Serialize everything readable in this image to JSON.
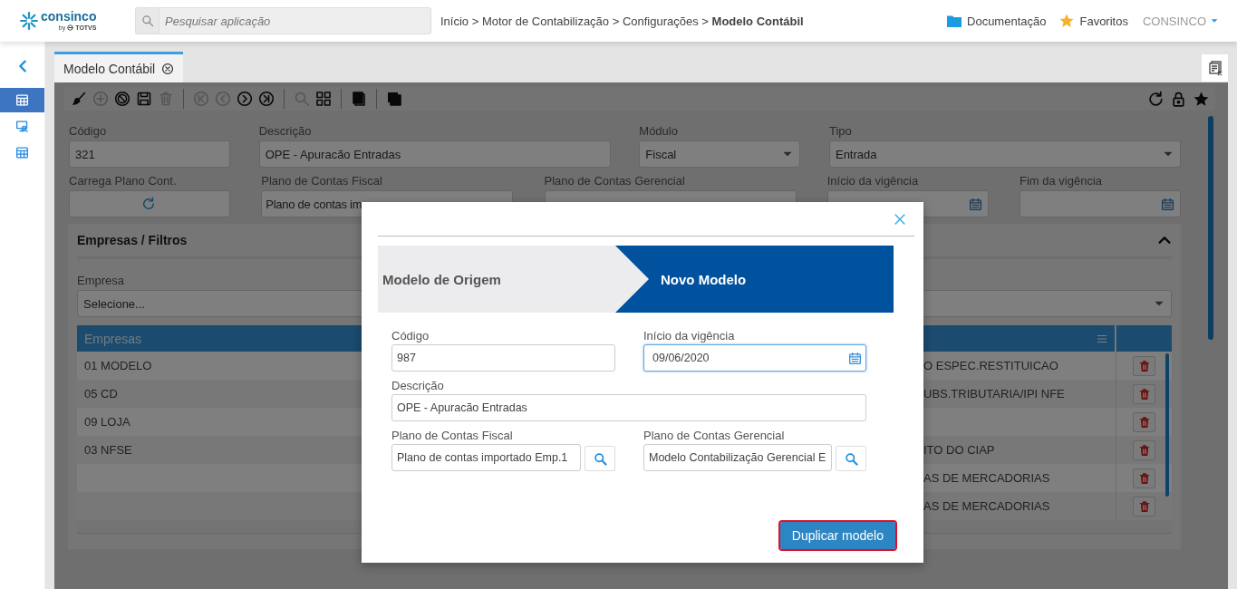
{
  "header": {
    "logo": {
      "name": "consinco",
      "byline": "by",
      "brand": "TOTVS"
    },
    "search": {
      "placeholder": "Pesquisar aplicação"
    },
    "breadcrumb": "Início > Motor de Contabilização > Configurações > **Modelo Contábil**",
    "links": [
      {
        "kind": "folder",
        "label": "Documentação"
      },
      {
        "kind": "star",
        "label": "Favoritos"
      }
    ],
    "user_menu": {
      "label": "CONSINCO"
    }
  },
  "sidebar": {
    "items": [
      {
        "kind": "grid",
        "selected": true
      },
      {
        "kind": "monitor",
        "selected": false
      },
      {
        "kind": "table",
        "selected": false
      }
    ]
  },
  "tabs": [
    {
      "label": "Modelo Contábil",
      "selected": true
    }
  ],
  "toolbar": {
    "groups": [
      {
        "items": [
          {
            "kind": "brush",
            "disabled": false
          },
          {
            "kind": "plus",
            "disabled": true
          },
          {
            "kind": "ban",
            "disabled": false
          },
          {
            "kind": "save",
            "disabled": false
          },
          {
            "kind": "trash",
            "disabled": true
          }
        ]
      },
      {
        "items": [
          {
            "kind": "first",
            "disabled": true
          },
          {
            "kind": "prev",
            "disabled": true
          },
          {
            "kind": "next",
            "disabled": false
          },
          {
            "kind": "last",
            "disabled": false
          }
        ]
      },
      {
        "items": [
          {
            "kind": "search",
            "disabled": true
          },
          {
            "kind": "grid",
            "disabled": false
          }
        ]
      },
      {
        "items": [
          {
            "kind": "copy",
            "disabled": false
          }
        ]
      },
      {
        "items": [
          {
            "kind": "layers",
            "disabled": false
          }
        ]
      }
    ],
    "right": [
      {
        "kind": "refresh",
        "disabled": false
      },
      {
        "kind": "lock",
        "disabled": false
      },
      {
        "kind": "star",
        "disabled": false
      }
    ]
  },
  "form": {
    "rows": [
      [
        {
          "kind": "text",
          "label": "Código",
          "value": "321"
        },
        {
          "kind": "text",
          "label": "Descrição",
          "value": "OPE - Apuracão Entradas"
        },
        {
          "kind": "select",
          "label": "Módulo",
          "value": "Fiscal"
        },
        {
          "kind": "select",
          "label": "Tipo",
          "value": "Entrada"
        }
      ],
      [
        {
          "kind": "button",
          "label": "Carrega Plano Cont."
        },
        {
          "kind": "text",
          "label": "Plano de Contas Fiscal",
          "value": "Plano de contas im"
        },
        {
          "kind": "text",
          "label": "Plano de Contas Gerencial"
        },
        {
          "kind": "date",
          "label": "Início da vigência"
        },
        {
          "kind": "date",
          "label": "Fim da vigência"
        }
      ]
    ]
  },
  "panel": {
    "title": "Empresas / Filtros",
    "expanded": true,
    "empresa": {
      "label": "Empresa",
      "value": "Selecione..."
    },
    "table": {
      "columns": [
        "Empresas"
      ],
      "rows": [
        {
          "empresa": "01 MODELO",
          "column_2": "O ESPEC.RESTITUICAO"
        },
        {
          "empresa": "05 CD",
          "column_2": "UBS.TRIBUTARIA/IPI NFE"
        },
        {
          "empresa": "09 LOJA"
        },
        {
          "empresa": "03 NFSE",
          "column_2": "ITO DO CIAP"
        },
        {
          "column_2": "AS DE MERCADORIAS"
        },
        {
          "column_2": "AS DE MERCADORIAS"
        }
      ]
    }
  },
  "modal": {
    "steps": [
      {
        "label": "Modelo de Origem",
        "selected": false
      },
      {
        "label": "Novo Modelo",
        "selected": true
      }
    ],
    "fields": [
      {
        "kind": "text",
        "label": "Código",
        "value": "987",
        "focused": false
      },
      {
        "kind": "date",
        "label": "Início da vigência",
        "value": "09/06/2020",
        "focused": true
      },
      {
        "kind": "text",
        "label": "Descrição",
        "value": "OPE - Apuracão Entradas",
        "focused": false
      },
      {
        "kind": "lookup",
        "label": "Plano de Contas Fiscal",
        "value": "Plano de contas importado Emp.1",
        "focused": false
      },
      {
        "kind": "lookup",
        "label": "Plano de Contas Gerencial",
        "value": "Modelo Contabilização Gerencial E",
        "focused": false
      }
    ],
    "button": {
      "label": "Duplicar modelo",
      "highlighted": true
    }
  }
}
